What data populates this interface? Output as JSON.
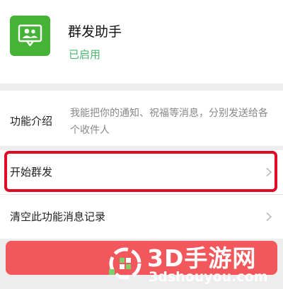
{
  "app": {
    "title": "群发助手",
    "status": "已启用",
    "icon": "group-chat-icon"
  },
  "intro": {
    "label": "功能介绍",
    "text": "我能把你的通知、祝福等消息，分别发送给各个收件人"
  },
  "actions": {
    "start_label": "开始群发",
    "clear_label": "清空此功能消息记录"
  },
  "watermark": {
    "brand": "3D手游网",
    "url": "3dshouyou.com"
  },
  "colors": {
    "accent_green": "#44b336",
    "status_green": "#4bb56d",
    "highlight_red": "#e00b25",
    "danger_button": "#f2575b",
    "watermark_text": "#ffffff"
  }
}
